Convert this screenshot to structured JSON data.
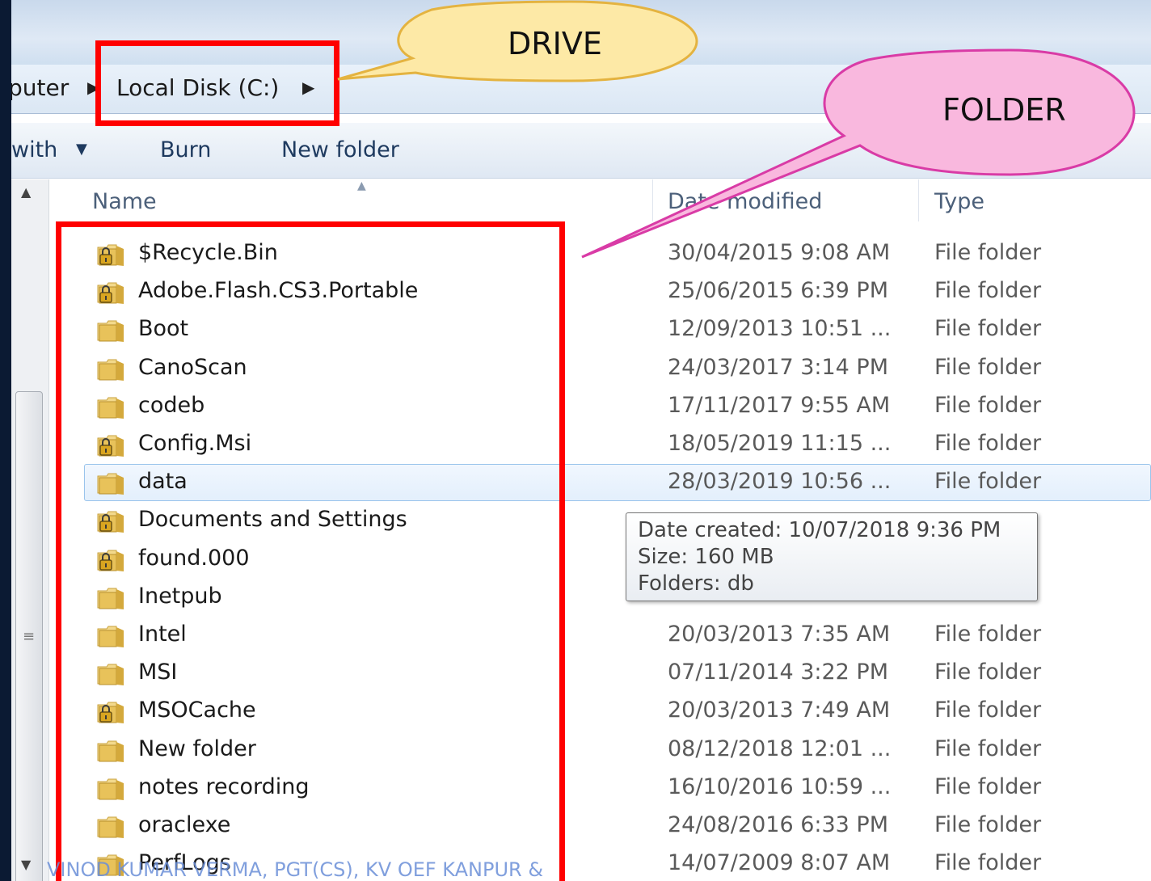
{
  "breadcrumb": {
    "partial_computer": "puter",
    "drive": "Local Disk (C:)"
  },
  "toolbar": {
    "open_with": "with",
    "burn": "Burn",
    "new_folder": "New folder"
  },
  "columns": {
    "name": "Name",
    "date_modified": "Date modified",
    "type": "Type"
  },
  "files": [
    {
      "name": "$Recycle.Bin",
      "date": "30/04/2015 9:08 AM",
      "type": "File folder",
      "locked": true
    },
    {
      "name": "Adobe.Flash.CS3.Portable",
      "date": "25/06/2015 6:39 PM",
      "type": "File folder",
      "locked": true
    },
    {
      "name": "Boot",
      "date": "12/09/2013 10:51 ...",
      "type": "File folder",
      "locked": false
    },
    {
      "name": "CanoScan",
      "date": "24/03/2017 3:14 PM",
      "type": "File folder",
      "locked": false
    },
    {
      "name": "codeb",
      "date": "17/11/2017 9:55 AM",
      "type": "File folder",
      "locked": false
    },
    {
      "name": "Config.Msi",
      "date": "18/05/2019 11:15 ...",
      "type": "File folder",
      "locked": true
    },
    {
      "name": "data",
      "date": "28/03/2019 10:56 ...",
      "type": "File folder",
      "locked": false
    },
    {
      "name": "Documents and Settings",
      "date": "",
      "type": "",
      "locked": true
    },
    {
      "name": "found.000",
      "date": "",
      "type": "",
      "locked": true
    },
    {
      "name": "Inetpub",
      "date": "",
      "type": "",
      "locked": false
    },
    {
      "name": "Intel",
      "date": "20/03/2013 7:35 AM",
      "type": "File folder",
      "locked": false
    },
    {
      "name": "MSI",
      "date": "07/11/2014 3:22 PM",
      "type": "File folder",
      "locked": false
    },
    {
      "name": "MSOCache",
      "date": "20/03/2013 7:49 AM",
      "type": "File folder",
      "locked": true
    },
    {
      "name": "New folder",
      "date": "08/12/2018 12:01 ...",
      "type": "File folder",
      "locked": false
    },
    {
      "name": "notes recording",
      "date": "16/10/2016 10:59 ...",
      "type": "File folder",
      "locked": false
    },
    {
      "name": "oraclexe",
      "date": "24/08/2016 6:33 PM",
      "type": "File folder",
      "locked": false
    },
    {
      "name": "PerfLogs",
      "date": "14/07/2009 8:07 AM",
      "type": "File folder",
      "locked": false
    }
  ],
  "selected_index": 6,
  "tooltip": {
    "date_created": "Date created: 10/07/2018 9:36 PM",
    "size": "Size: 160 MB",
    "folders": "Folders: db"
  },
  "callouts": {
    "drive": "DRIVE",
    "folder": "FOLDER"
  },
  "watermark": "VINOD KUMAR VERMA, PGT(CS), KV OEF KANPUR &",
  "colors": {
    "highlight": "#ff0000",
    "drive_callout_fill": "#fde9a6",
    "folder_callout_fill": "#f9b8de",
    "folder_icon": "#e8c25a"
  },
  "icons": {
    "folder": "folder-icon",
    "locked_folder": "locked-folder-icon",
    "breadcrumb_arrow": "chevron-right-icon",
    "dropdown": "chevron-down-icon",
    "sort": "sort-up-icon"
  }
}
